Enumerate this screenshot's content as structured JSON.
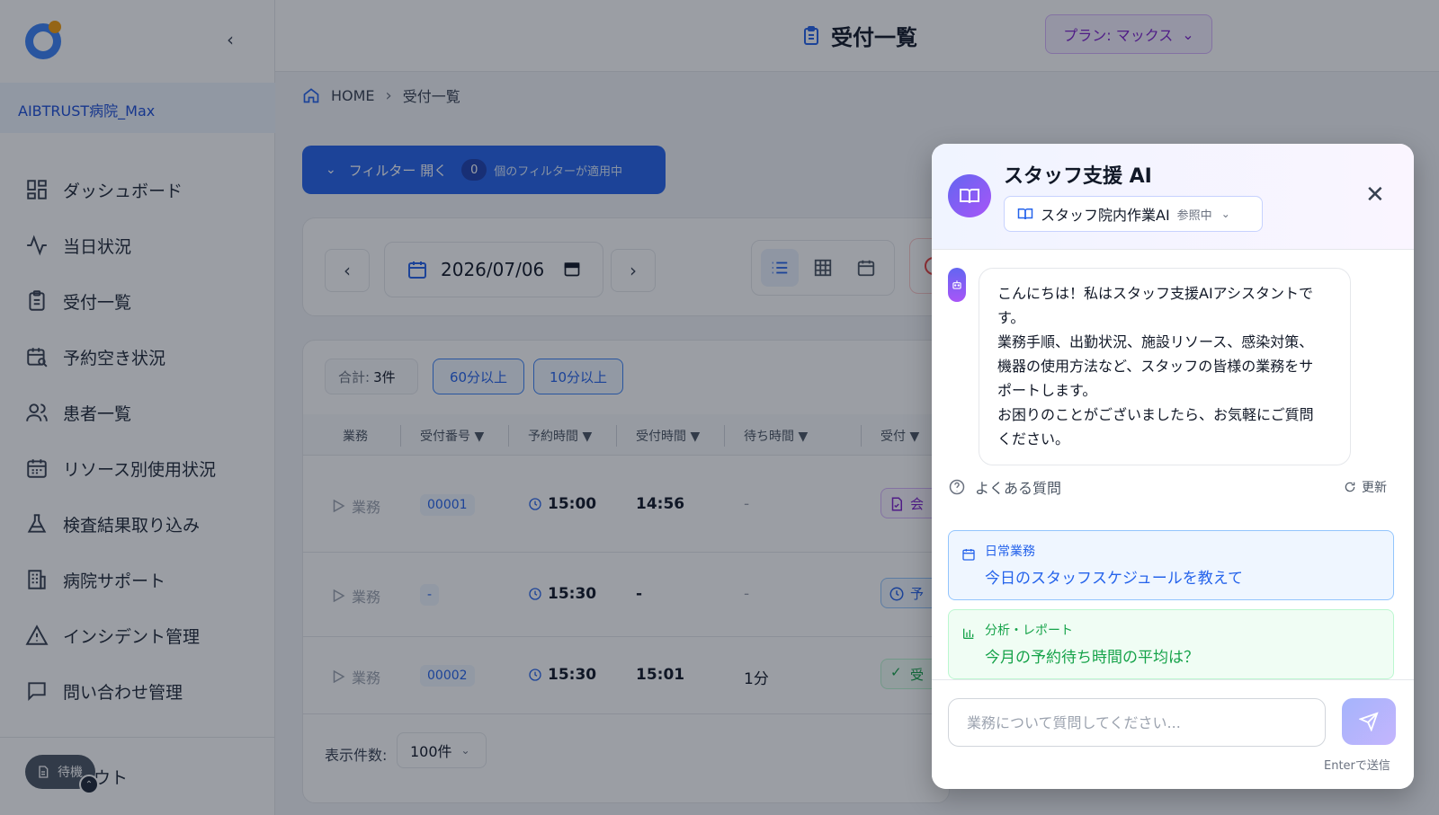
{
  "sidebar": {
    "hospital": "AIBTRUST病院_Max",
    "items": [
      {
        "label": "ダッシュボード",
        "icon": "dashboard-icon"
      },
      {
        "label": "当日状況",
        "icon": "activity-icon"
      },
      {
        "label": "受付一覧",
        "icon": "clipboard-icon"
      },
      {
        "label": "予約空き状況",
        "icon": "calendar-search-icon"
      },
      {
        "label": "患者一覧",
        "icon": "users-icon"
      },
      {
        "label": "リソース別使用状況",
        "icon": "calendar-grid-icon"
      },
      {
        "label": "検査結果取り込み",
        "icon": "flask-icon"
      },
      {
        "label": "病院サポート",
        "icon": "building-icon"
      },
      {
        "label": "インシデント管理",
        "icon": "warning-icon"
      },
      {
        "label": "問い合わせ管理",
        "icon": "message-icon"
      }
    ],
    "logout_partial": "グアウト",
    "wait_label": "待機"
  },
  "header": {
    "title": "受付一覧",
    "plan": "プラン: マックス"
  },
  "breadcrumb": {
    "home": "HOME",
    "current": "受付一覧"
  },
  "filter": {
    "label": "フィルター 開く",
    "count": "0",
    "applied": "個のフィルターが適用中"
  },
  "date": {
    "value": "2026/07/06"
  },
  "table": {
    "total_label": "合計:",
    "total_value": "3件",
    "btn_60": "60分以上",
    "btn_10": "10分以上",
    "columns": [
      "業務",
      "受付番号 ▼",
      "予約時間 ▼",
      "受付時間 ▼",
      "待ち時間 ▼",
      "受付 ▼"
    ],
    "rows": [
      {
        "task": "業務",
        "number": "00001",
        "reserved": "15:00",
        "received": "14:56",
        "wait": "-",
        "status_partial": "会"
      },
      {
        "task": "業務",
        "number": "-",
        "reserved": "15:30",
        "received": "-",
        "wait": "-",
        "status_partial": "予"
      },
      {
        "task": "業務",
        "number": "00002",
        "reserved": "15:30",
        "received": "15:01",
        "wait": "1分",
        "status_partial": "受"
      }
    ],
    "perpage_label": "表示件数:",
    "perpage_value": "100件"
  },
  "chat": {
    "title": "スタッフ支援 AI",
    "ai_name": "スタッフ院内作業AI",
    "ai_ref": "参照中",
    "message_lines": [
      "こんにちは！私はスタッフ支援AIアシスタントで",
      "す。",
      "業務手順、出勤状況、施設リソース、感染対策、",
      "機器の使用方法など、スタッフの皆様の業務をサ",
      "ポートします。",
      "お困りのことがございましたら、お気軽にご質問",
      "ください。"
    ],
    "faq_title": "よくある質問",
    "refresh": "更新",
    "faqs": [
      {
        "category": "日常業務",
        "question": "今日のスタッフスケジュールを教えて"
      },
      {
        "category": "分析・レポート",
        "question": "今月の予約待ち時間の平均は？"
      }
    ],
    "input_placeholder": "業務について質問してください...",
    "enter_hint": "Enterで送信"
  },
  "colors": {
    "accent": "#2563eb",
    "plan": "#7e22ce",
    "faq_blue": "#2563eb",
    "faq_green": "#16a34a"
  }
}
